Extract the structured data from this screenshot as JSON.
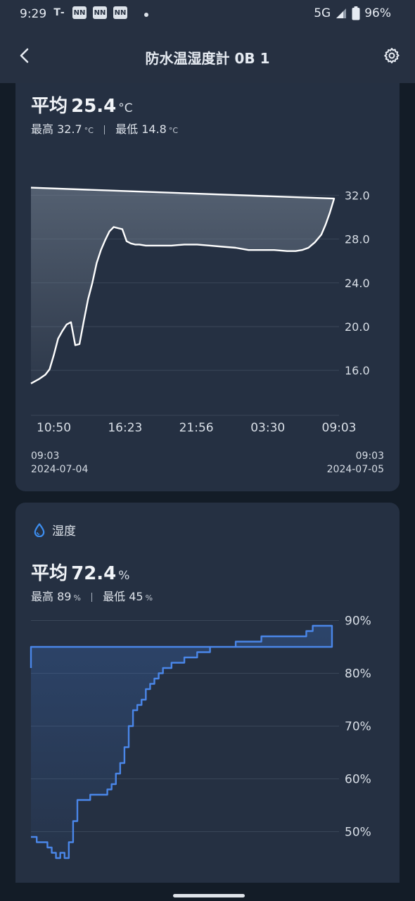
{
  "status_bar": {
    "time": "9:29",
    "network": "5G",
    "battery": "96%",
    "notification_icons": [
      "transit-app-icon",
      "news-app-icon",
      "news-app-icon",
      "news-app-icon"
    ]
  },
  "header": {
    "title": "防水温湿度計 0B 1",
    "back_icon": "chevron-left-icon",
    "settings_icon": "gear-icon"
  },
  "temperature": {
    "avg_label": "平均",
    "avg_value": "25.4",
    "unit": "°C",
    "max_label": "最高",
    "max_value": "32.7",
    "min_label": "最低",
    "min_value": "14.8",
    "range_start_time": "09:03",
    "range_start_date": "2024-07-04",
    "range_end_time": "09:03",
    "range_end_date": "2024-07-05"
  },
  "humidity": {
    "section_label": "湿度",
    "section_icon": "water-drop-icon",
    "avg_label": "平均",
    "avg_value": "72.4",
    "unit": "%",
    "max_label": "最高",
    "max_value": "89",
    "min_label": "最低",
    "min_value": "45"
  },
  "chart_data": [
    {
      "type": "area",
      "xlabel": "",
      "ylabel": "",
      "ylim": [
        13.5,
        32.8
      ],
      "yticks": [
        16.0,
        20.0,
        24.0,
        28.0,
        32.0
      ],
      "ytick_labels": [
        "16.0",
        "20.0",
        "24.0",
        "28.0",
        "32.0"
      ],
      "x_labels": [
        "10:50",
        "16:23",
        "21:56",
        "03:30",
        "09:03"
      ],
      "grid": true,
      "color": "#ffffff",
      "series": [
        {
          "x": [
            "09:03",
            "09:40",
            "10:10",
            "10:30",
            "10:50",
            "11:10",
            "11:30",
            "11:50",
            "12:10",
            "12:30",
            "12:50",
            "13:10",
            "13:30",
            "13:50",
            "14:10",
            "14:30",
            "14:50",
            "15:10",
            "15:30",
            "15:50",
            "16:10",
            "16:30",
            "16:50",
            "17:10",
            "17:30",
            "18:00",
            "19:00",
            "20:00",
            "21:00",
            "22:00",
            "23:00",
            "00:00",
            "01:00",
            "02:00",
            "03:00",
            "04:00",
            "05:00",
            "05:40",
            "06:10",
            "06:40",
            "07:10",
            "07:40",
            "08:00",
            "08:20",
            "08:40",
            "09:03"
          ],
          "values": [
            14.8,
            15.2,
            15.6,
            16.1,
            17.4,
            18.9,
            19.6,
            20.2,
            20.4,
            18.3,
            18.4,
            20.5,
            22.5,
            24.0,
            25.8,
            27.0,
            27.9,
            28.7,
            29.1,
            29.0,
            28.9,
            27.8,
            27.6,
            27.5,
            27.5,
            27.4,
            27.4,
            27.4,
            27.5,
            27.5,
            27.4,
            27.3,
            27.2,
            27.0,
            27.0,
            27.0,
            26.9,
            26.9,
            27.0,
            27.2,
            27.7,
            28.4,
            29.3,
            30.4,
            31.7,
            32.7
          ]
        }
      ]
    },
    {
      "type": "line",
      "xlabel": "",
      "ylabel": "",
      "ylim": [
        43,
        91
      ],
      "yticks": [
        50,
        60,
        70,
        80,
        90
      ],
      "ytick_labels": [
        "50%",
        "60%",
        "70%",
        "80%",
        "90%"
      ],
      "grid": true,
      "color": "#4a86e8",
      "series": [
        {
          "x": [
            "09:03",
            "09:30",
            "10:00",
            "10:20",
            "10:40",
            "11:00",
            "11:20",
            "11:40",
            "12:00",
            "12:20",
            "12:40",
            "13:00",
            "13:20",
            "13:40",
            "14:00",
            "14:30",
            "15:00",
            "15:20",
            "15:40",
            "16:00",
            "16:20",
            "16:40",
            "17:00",
            "17:20",
            "17:40",
            "18:00",
            "18:20",
            "18:40",
            "19:00",
            "19:20",
            "19:40",
            "20:00",
            "20:30",
            "21:00",
            "21:30",
            "22:00",
            "22:30",
            "23:00",
            "00:00",
            "01:00",
            "02:00",
            "03:00",
            "04:00",
            "05:00",
            "06:00",
            "06:30",
            "07:00",
            "07:30",
            "08:00",
            "08:30",
            "09:03"
          ],
          "values": [
            49,
            48,
            48,
            47,
            46,
            45,
            46,
            45,
            48,
            52,
            56,
            56,
            56,
            57,
            57,
            57,
            58,
            59,
            61,
            63,
            66,
            70,
            73,
            74,
            75,
            77,
            78,
            79,
            80,
            81,
            81,
            82,
            82,
            83,
            83,
            84,
            84,
            85,
            85,
            86,
            86,
            87,
            87,
            87,
            87,
            88,
            89,
            89,
            89,
            85,
            81
          ]
        }
      ]
    }
  ]
}
